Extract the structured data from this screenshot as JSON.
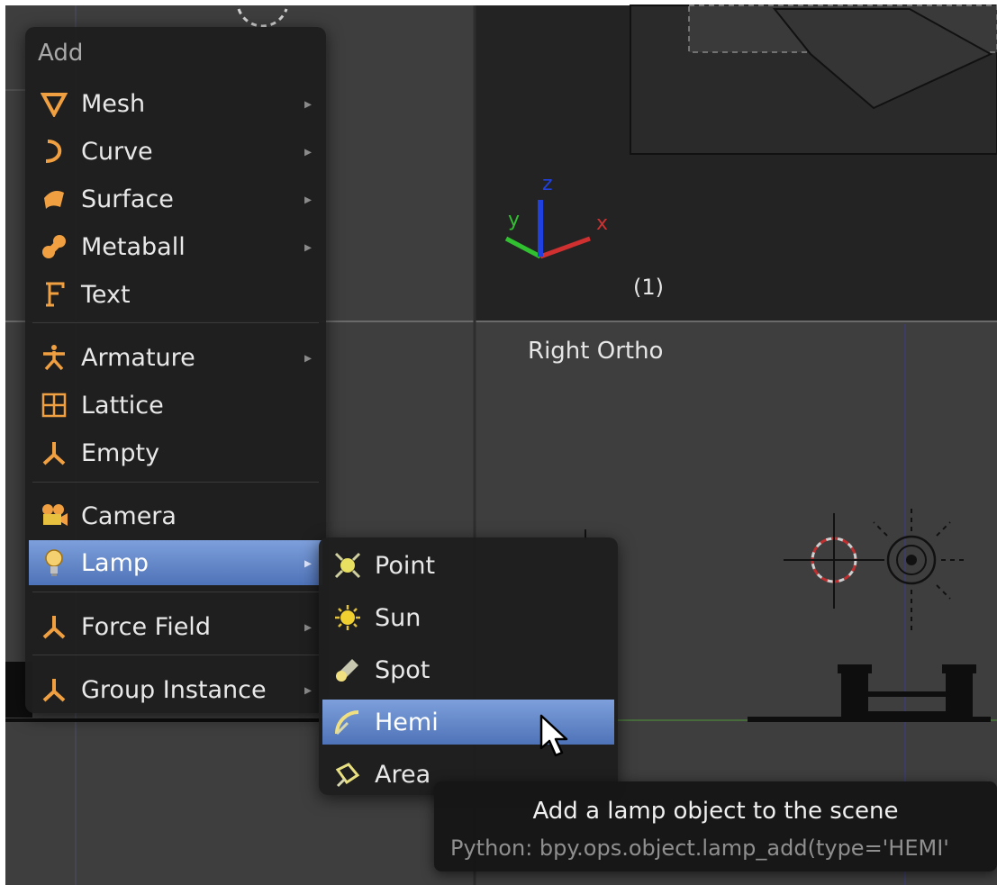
{
  "viewport": {
    "top_right_label": "(1)",
    "bottom_view_label": "Right Ortho",
    "axes": {
      "x": "x",
      "y": "y",
      "z": "z"
    }
  },
  "add_menu": {
    "title": "Add",
    "items": [
      {
        "label": "Mesh",
        "icon": "mesh-icon",
        "has_submenu": true
      },
      {
        "label": "Curve",
        "icon": "curve-icon",
        "has_submenu": true
      },
      {
        "label": "Surface",
        "icon": "surface-icon",
        "has_submenu": true
      },
      {
        "label": "Metaball",
        "icon": "metaball-icon",
        "has_submenu": true
      },
      {
        "label": "Text",
        "icon": "text-icon",
        "has_submenu": false
      },
      {
        "label": "Armature",
        "icon": "armature-icon",
        "has_submenu": true
      },
      {
        "label": "Lattice",
        "icon": "lattice-icon",
        "has_submenu": false
      },
      {
        "label": "Empty",
        "icon": "empty-icon",
        "has_submenu": true
      },
      {
        "label": "Camera",
        "icon": "camera-icon",
        "has_submenu": false
      },
      {
        "label": "Lamp",
        "icon": "lamp-icon",
        "has_submenu": true,
        "active": true
      },
      {
        "label": "Force Field",
        "icon": "force-field-icon",
        "has_submenu": true
      },
      {
        "label": "Group Instance",
        "icon": "group-instance-icon",
        "has_submenu": true
      }
    ]
  },
  "lamp_submenu": {
    "items": [
      {
        "label": "Point",
        "icon": "point-lamp-icon"
      },
      {
        "label": "Sun",
        "icon": "sun-lamp-icon"
      },
      {
        "label": "Spot",
        "icon": "spot-lamp-icon"
      },
      {
        "label": "Hemi",
        "icon": "hemi-lamp-icon",
        "hovered": true
      },
      {
        "label": "Area",
        "icon": "area-lamp-icon"
      }
    ]
  },
  "tooltip": {
    "description": "Add a lamp object to the scene",
    "python": "Python: bpy.ops.object.lamp_add(type='HEMI'"
  },
  "colors": {
    "menu_bg": "#1e1e1e",
    "highlight": "#5a7fc4",
    "icon_orange": "#f0a040",
    "viewport_bg": "#3d3d3d",
    "grid_line": "#555555",
    "axis_x": "#d03030",
    "axis_y": "#30c030",
    "axis_z": "#2040e0"
  }
}
